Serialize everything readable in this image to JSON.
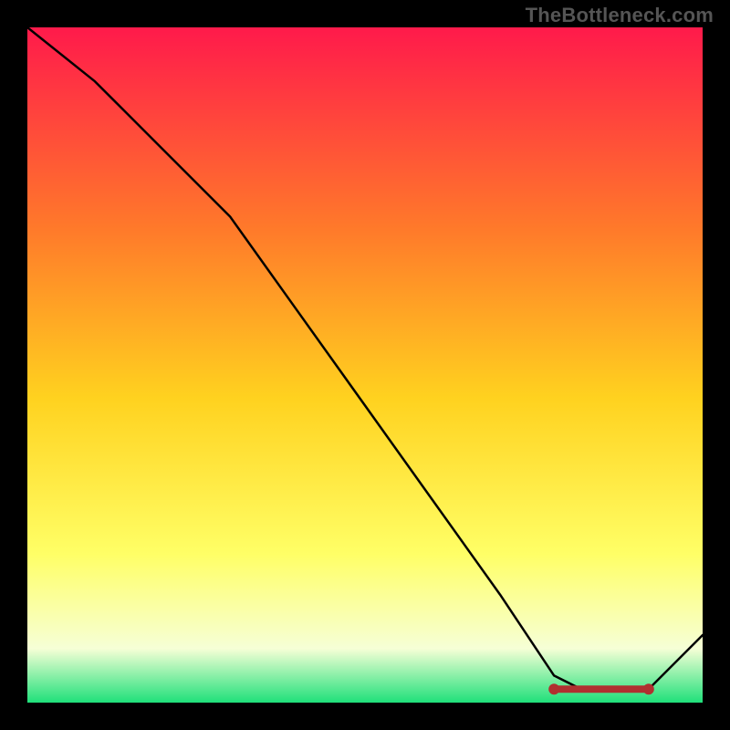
{
  "watermark": "TheBottleneck.com",
  "chart_data": {
    "type": "line",
    "title": "",
    "xlabel": "",
    "ylabel": "",
    "xlim": [
      0,
      100
    ],
    "ylim": [
      0,
      100
    ],
    "grid": false,
    "series": [
      {
        "name": "curve",
        "color": "#000000",
        "x": [
          0,
          10,
          20,
          30,
          40,
          50,
          60,
          70,
          78,
          82,
          88,
          92,
          100
        ],
        "y": [
          100,
          92,
          82,
          72,
          58,
          44,
          30,
          16,
          4,
          2,
          2,
          2,
          10
        ]
      }
    ],
    "optimal_band": {
      "x_start": 78,
      "x_end": 92,
      "y": 2
    },
    "gradient": {
      "top": "#ff1a4b",
      "mid1": "#ff7a2a",
      "mid2": "#ffd21f",
      "mid3": "#ffff66",
      "mid4": "#f6ffd6",
      "bottom": "#1fe07a"
    }
  }
}
